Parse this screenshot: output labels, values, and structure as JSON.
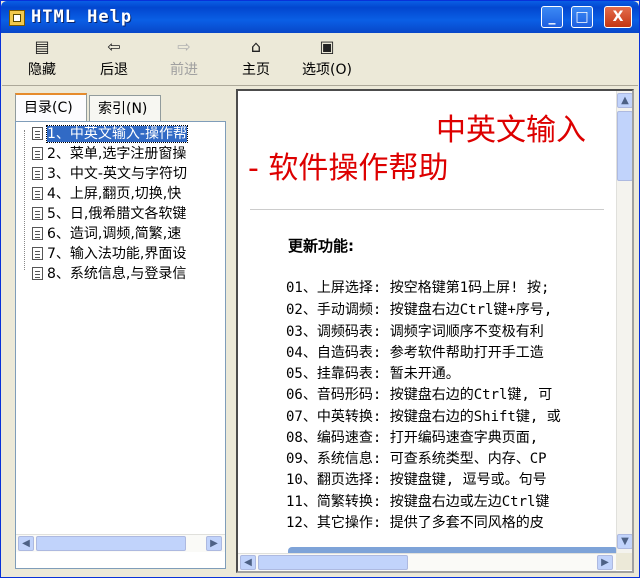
{
  "window": {
    "title": "HTML Help"
  },
  "title_buttons": {
    "minimize": "_",
    "maximize": "□",
    "close": "X"
  },
  "toolbar": {
    "hide_label": "隐藏",
    "back_label": "后退",
    "forward_label": "前进",
    "home_label": "主页",
    "options_label": "选项(O)"
  },
  "tabs": {
    "contents_label": "目录(C)",
    "index_label": "索引(N)"
  },
  "tree": {
    "items": [
      "1、中英文输入-操作帮",
      "2、菜单,选字注册窗操",
      "3、中文-英文与字符切",
      "4、上屏,翻页,切换,快",
      "5、日,俄希腊文各软键",
      "6、造词,调频,简繁,速",
      "7、输入法功能,界面设",
      "8、系统信息,与登录信"
    ],
    "selected_index": 0
  },
  "content": {
    "heading_line1": "中英文输入",
    "heading_line2": "- 软件操作帮助",
    "subhead": "更新功能:",
    "lines": [
      "01、上屏选择: 按空格键第1码上屏! 按;",
      "02、手动调频: 按键盘右边Ctrl键+序号,",
      "03、调频码表: 调频字词顺序不变极有利",
      "04、自造码表: 参考软件帮助打开手工造",
      "05、挂靠码表: 暂未开通。",
      "06、音码形码: 按键盘右边的Ctrl键, 可",
      "07、中英转换: 按键盘右边的Shift键, 或",
      "08、编码速查: 打开编码速查字典页面,",
      "09、系统信息: 可查系统类型、内存、CP",
      "10、翻页选择: 按键盘键, 逗号或。句号",
      "11、简繁转换: 按键盘右边或左边Ctrl键",
      "12、其它操作: 提供了多套不同风格的皮"
    ]
  },
  "colors": {
    "heading": "#dd0000",
    "titlebar": "#0a5fe5",
    "selection": "#316ac5"
  },
  "icons": {
    "hide": "hide-pane-icon",
    "back": "back-arrow-icon",
    "forward": "forward-arrow-icon",
    "home": "home-icon",
    "options": "options-icon",
    "doc": "document-icon"
  }
}
